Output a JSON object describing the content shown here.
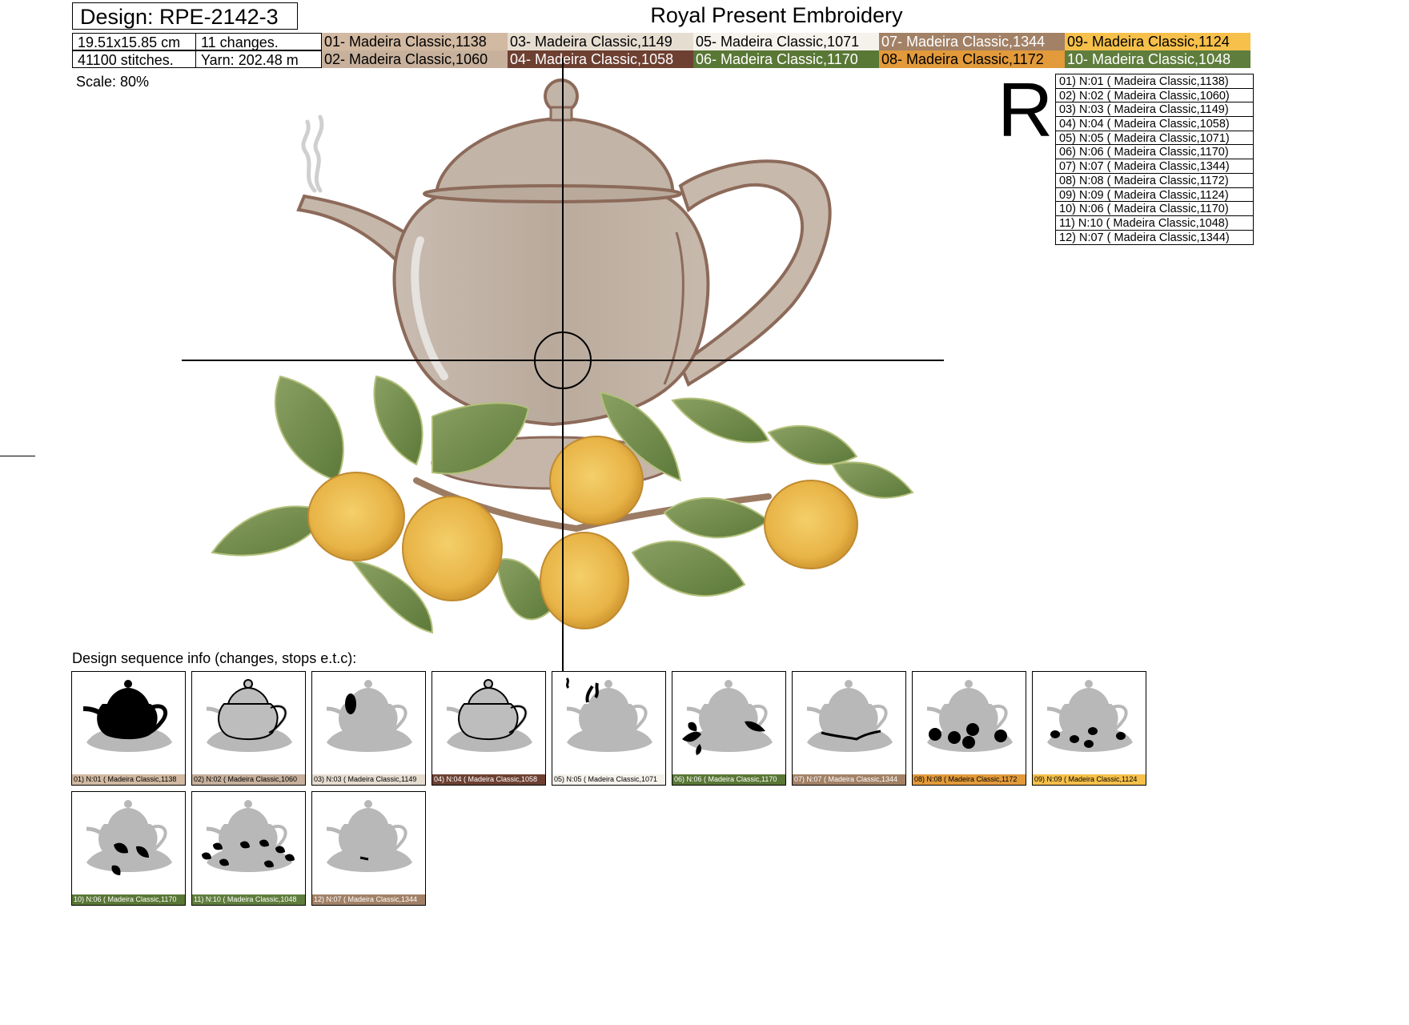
{
  "header": {
    "design_label": "Design: RPE-2142-3",
    "brand": "Royal Present Embroidery",
    "size": "19.51x15.85 cm",
    "changes": "11 changes.",
    "stitches": "41100 stitches.",
    "yarn": "Yarn: 202.48 m",
    "scale": "Scale: 80%",
    "r_mark": "R"
  },
  "palette": [
    {
      "label": "01- Madeira Classic,1138",
      "color": "#d2b9a2",
      "text_color": "#000000"
    },
    {
      "label": "02- Madeira Classic,1060",
      "color": "#c7b19c",
      "text_color": "#000000"
    },
    {
      "label": "03- Madeira Classic,1149",
      "color": "#e6ddd1",
      "text_color": "#000000"
    },
    {
      "label": "04- Madeira Classic,1058",
      "color": "#6d4032",
      "text_color": "#ffffff"
    },
    {
      "label": "05- Madeira Classic,1071",
      "color": "#f5f2ec",
      "text_color": "#000000"
    },
    {
      "label": "06- Madeira Classic,1170",
      "color": "#597735",
      "text_color": "#ffffff"
    },
    {
      "label": "07- Madeira Classic,1344",
      "color": "#a28166",
      "text_color": "#ffffff"
    },
    {
      "label": "08- Madeira Classic,1172",
      "color": "#e29a3b",
      "text_color": "#000000"
    },
    {
      "label": "09- Madeira Classic,1124",
      "color": "#f6c04a",
      "text_color": "#000000"
    },
    {
      "label": "10- Madeira Classic,1048",
      "color": "#5f7d3c",
      "text_color": "#ffffff"
    }
  ],
  "sequence_table": [
    "01) N:01 ( Madeira Classic,1138)",
    "02) N:02 ( Madeira Classic,1060)",
    "03) N:03 ( Madeira Classic,1149)",
    "04) N:04 ( Madeira Classic,1058)",
    "05) N:05 ( Madeira Classic,1071)",
    "06) N:06 ( Madeira Classic,1170)",
    "07) N:07 ( Madeira Classic,1344)",
    "08) N:08 ( Madeira Classic,1172)",
    "09) N:09 ( Madeira Classic,1124)",
    "10) N:06 ( Madeira Classic,1170)",
    "11) N:10 ( Madeira Classic,1048)",
    "12) N:07 ( Madeira Classic,1344)"
  ],
  "sequence_heading": "Design sequence info (changes, stops e.t.c):",
  "thumbnails": [
    {
      "label": "01) N:01 ( Madeira Classic,1138",
      "color": "#d2b9a2",
      "text_color": "#000000",
      "highlight": "teapot-body"
    },
    {
      "label": "02) N:02 ( Madeira Classic,1060",
      "color": "#c7b19c",
      "text_color": "#000000",
      "highlight": "teapot-outline"
    },
    {
      "label": "03) N:03 ( Madeira Classic,1149",
      "color": "#e6ddd1",
      "text_color": "#000000",
      "highlight": "reflection"
    },
    {
      "label": "04) N:04 ( Madeira Classic,1058",
      "color": "#6d4032",
      "text_color": "#ffffff",
      "highlight": "teapot-contour"
    },
    {
      "label": "05) N:05 ( Madeira Classic,1071",
      "color": "#f5f2ec",
      "text_color": "#000000",
      "highlight": "steam"
    },
    {
      "label": "06) N:06 ( Madeira Classic,1170",
      "color": "#597735",
      "text_color": "#ffffff",
      "highlight": "leaves-a"
    },
    {
      "label": "07) N:07 ( Madeira Classic,1344",
      "color": "#a28166",
      "text_color": "#ffffff",
      "highlight": "branch"
    },
    {
      "label": "08) N:08 ( Madeira Classic,1172",
      "color": "#e29a3b",
      "text_color": "#000000",
      "highlight": "fruit"
    },
    {
      "label": "09) N:09 ( Madeira Classic,1124",
      "color": "#f6c04a",
      "text_color": "#000000",
      "highlight": "fruit-light"
    },
    {
      "label": "10) N:06 ( Madeira Classic,1170",
      "color": "#597735",
      "text_color": "#ffffff",
      "highlight": "leaves-b"
    },
    {
      "label": "11) N:10 ( Madeira Classic,1048",
      "color": "#5f7d3c",
      "text_color": "#ffffff",
      "highlight": "leaves-c"
    },
    {
      "label": "12) N:07 ( Madeira Classic,1344",
      "color": "#a28166",
      "text_color": "#ffffff",
      "highlight": "stem"
    }
  ]
}
